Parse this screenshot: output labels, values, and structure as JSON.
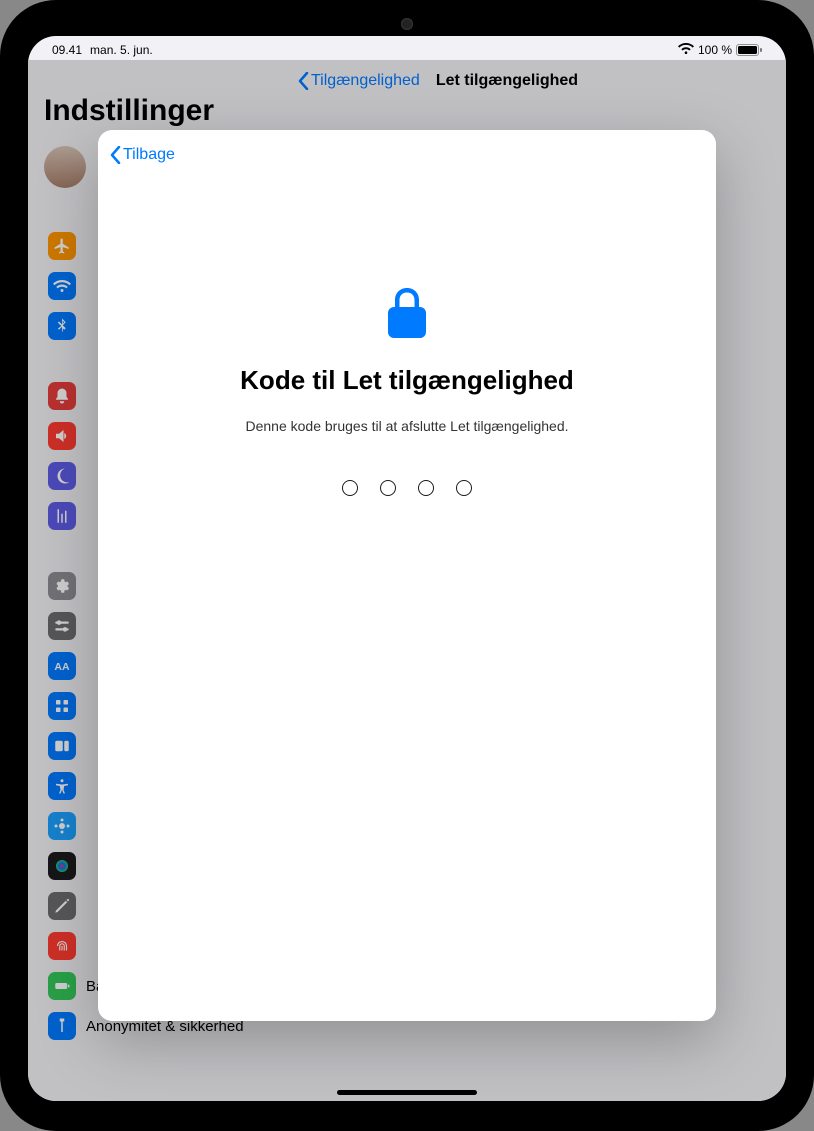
{
  "status_bar": {
    "time": "09.41",
    "date": "man. 5. jun.",
    "battery_pct": "100 %"
  },
  "background": {
    "sidebar_title": "Indstillinger",
    "nav_back_label": "Tilgængelighed",
    "nav_title": "Let tilgængelighed",
    "visible_rows": {
      "battery": "Batteri",
      "privacy": "Anonymitet & sikkerhed"
    },
    "icons": {
      "airplane": "airplane-icon",
      "wifi": "wifi-icon",
      "bluetooth": "bluetooth-icon",
      "notifications": "notifications-icon",
      "sounds": "sounds-icon",
      "focus": "focus-icon",
      "screentime": "screentime-icon",
      "general": "general-icon",
      "control_center": "control-center-icon",
      "display": "display-icon",
      "homescreen": "homescreen-icon",
      "multitasking": "multitasking-icon",
      "accessibility": "accessibility-icon",
      "wallpaper": "wallpaper-icon",
      "siri": "siri-icon",
      "pencil": "apple-pencil-icon",
      "touchid": "touchid-icon",
      "battery": "battery-icon",
      "privacy": "privacy-icon"
    }
  },
  "modal": {
    "back_label": "Tilbage",
    "title": "Kode til Let tilgængelighed",
    "subtitle": "Denne kode bruges til at afslutte Let tilgængelighed.",
    "passcode_length": 4
  }
}
